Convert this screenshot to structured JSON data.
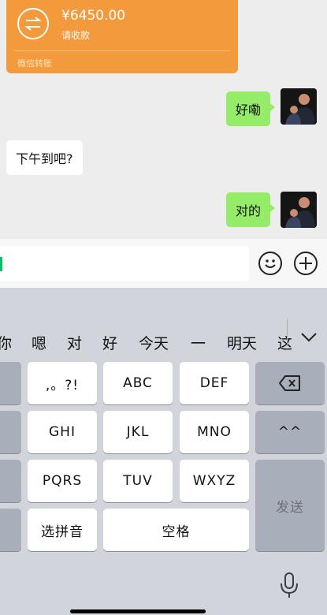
{
  "chat": {
    "transfer": {
      "amount": "¥6450.00",
      "status": "请收款",
      "footer": "微信转账"
    },
    "messages": [
      {
        "side": "right",
        "text": "好嘞"
      },
      {
        "side": "left",
        "text": "下午到吧?"
      },
      {
        "side": "right",
        "text": "对的"
      }
    ]
  },
  "input": {
    "value": ""
  },
  "keyboard": {
    "candidates": [
      "你",
      "嗯",
      "对",
      "好",
      "今天",
      "一",
      "明天",
      "这"
    ],
    "keys": {
      "punct": ",。?!",
      "abc": "ABC",
      "def": "DEF",
      "ghi": "GHI",
      "jkl": "JKL",
      "mno": "MNO",
      "emoticon": "^^",
      "pqrs": "PQRS",
      "tuv": "TUV",
      "wxyz": "WXYZ",
      "send": "发送",
      "pinyin": "选拼音",
      "space": "空格"
    }
  },
  "colors": {
    "transfer_bg": "#f39b3c",
    "my_bubble": "#95ec69",
    "cursor": "#07c160"
  }
}
